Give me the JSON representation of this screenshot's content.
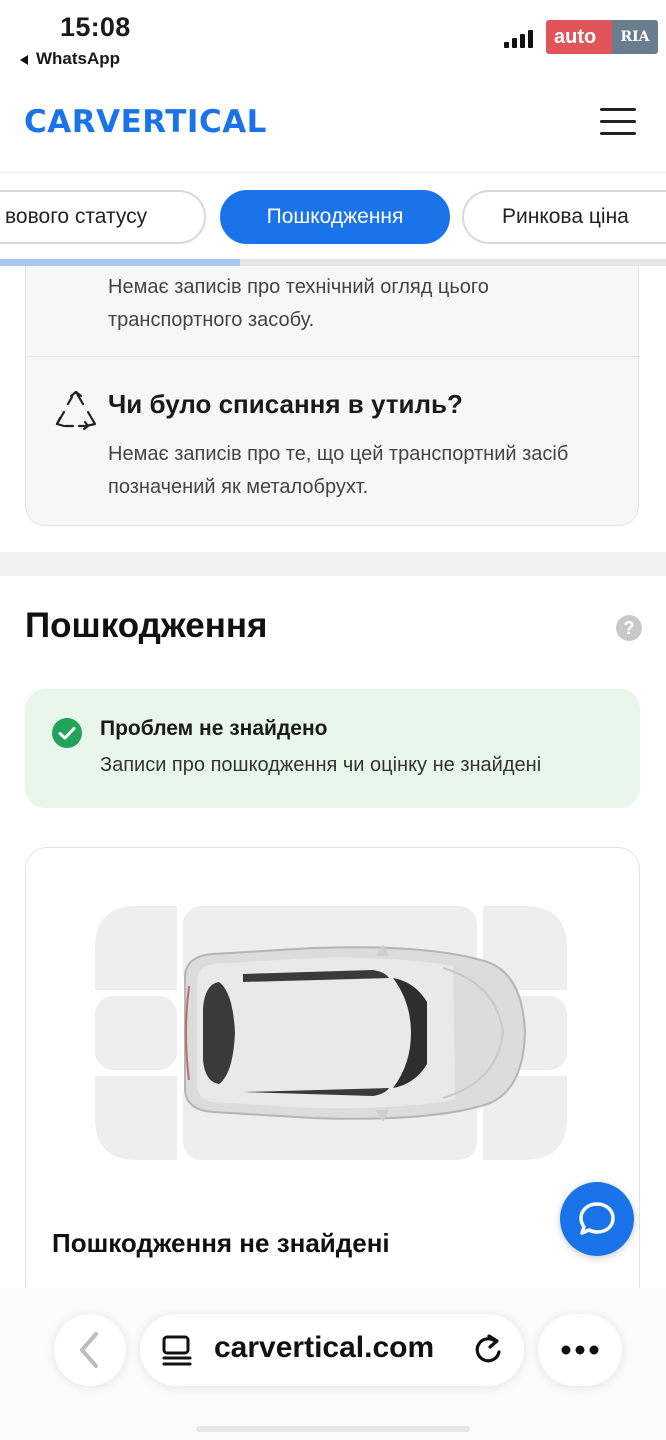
{
  "status_bar": {
    "time": "15:08",
    "back_app": "WhatsApp",
    "watermark_left": "auto",
    "watermark_right": "RIA"
  },
  "header": {
    "logo": "CARVERTICAL",
    "menu_icon": "hamburger-menu-icon",
    "brand_color": "#1a73e8"
  },
  "tabs": {
    "items": [
      {
        "label": "вового статусу",
        "active": false
      },
      {
        "label": "Пошкодження",
        "active": true
      },
      {
        "label": "Ринкова ціна",
        "active": false
      }
    ],
    "scroll_progress": 0.36
  },
  "records": {
    "inspection_text": "Немає записів про технічний огляд цього транспортного засобу.",
    "scrap_icon": "recycle-icon",
    "scrap_title": "Чи було списання в утиль?",
    "scrap_text": "Немає записів про те, що цей транспортний засіб позначений як металобрухт."
  },
  "damage": {
    "title": "Пошкодження",
    "help_icon": "?",
    "notice_title": "Проблем не знайдено",
    "notice_text": "Записи про пошкодження чи оцінку не знайдені",
    "diagram_label": "Пошкодження не знайдені",
    "success_color": "#22a35a"
  },
  "browser": {
    "url": "carvertical.com",
    "back_icon": "chevron-left-icon",
    "reader_icon": "reader-mode-icon",
    "reload_icon": "reload-icon",
    "more_icon": "more-dots-icon"
  }
}
